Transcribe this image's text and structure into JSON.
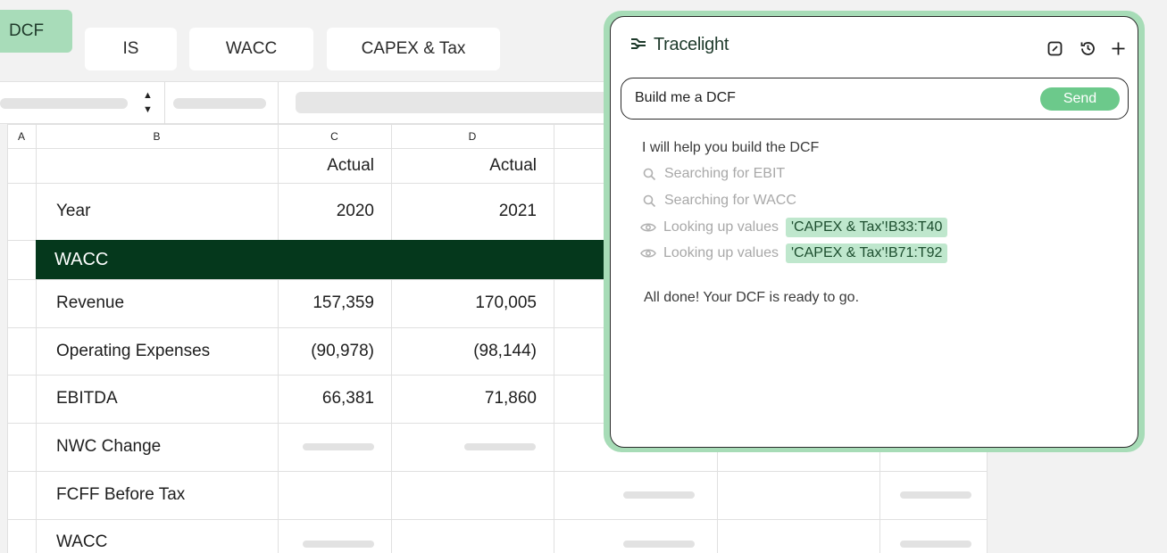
{
  "tabs": {
    "active": "DCF",
    "items": [
      "IS",
      "WACC",
      "CAPEX & Tax"
    ]
  },
  "toolbar": {
    "stepper_up": "▲",
    "stepper_down": "▼"
  },
  "sheet": {
    "col_headers": [
      "A",
      "B",
      "C",
      "D"
    ],
    "header_row": {
      "c": "Actual",
      "d": "Actual"
    },
    "year_row": {
      "label": "Year",
      "c": "2020",
      "d": "2021"
    },
    "section_band": "WACC",
    "rows": [
      {
        "label": "Revenue",
        "c": "157,359",
        "d": "170,005"
      },
      {
        "label": "Operating Expenses",
        "c": "(90,978)",
        "d": "(98,144)"
      },
      {
        "label": "EBITDA",
        "c": "66,381",
        "d": "71,860"
      },
      {
        "label": "NWC Change",
        "c": "",
        "d": ""
      },
      {
        "label": "FCFF Before Tax",
        "c": "",
        "d": ""
      },
      {
        "label": "WACC",
        "c": "",
        "d": ""
      }
    ]
  },
  "assistant": {
    "brand": "Tracelight",
    "icons": [
      "edit-icon",
      "history-icon",
      "plus-icon"
    ],
    "input_value": "Build me a DCF",
    "send_label": "Send",
    "intro": "I will help you build the DCF",
    "steps": [
      {
        "icon": "search-icon",
        "text": "Searching for EBIT",
        "chip": ""
      },
      {
        "icon": "search-icon",
        "text": "Searching for WACC",
        "chip": ""
      },
      {
        "icon": "eye-icon",
        "text": "Looking up values",
        "chip": "'CAPEX & Tax'!B33:T40"
      },
      {
        "icon": "eye-icon",
        "text": "Looking up values",
        "chip": "'CAPEX & Tax'!B71:T92"
      }
    ],
    "done": "All done! Your DCF is ready to go."
  },
  "colors": {
    "accent": "#6cc98b",
    "band": "#05381c",
    "chip": "#bfe7cd"
  }
}
